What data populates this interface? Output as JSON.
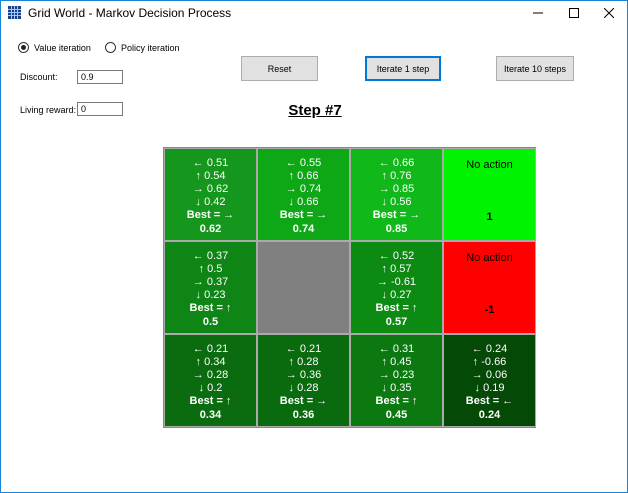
{
  "window": {
    "title": "Grid World - Markov Decision Process"
  },
  "controls": {
    "value_iteration_label": "Value iteration",
    "policy_iteration_label": "Policy iteration",
    "discount_label": "Discount:",
    "discount_value": "0.9",
    "living_reward_label": "Living reward:",
    "living_reward_value": "0",
    "selected_mode": "value_iteration"
  },
  "buttons": {
    "reset": "Reset",
    "iterate_1": "Iterate 1 step",
    "iterate_10": "Iterate 10 steps"
  },
  "step_title": "Step #7",
  "grid": {
    "rows": [
      [
        {
          "type": "q",
          "bg": "#15961c",
          "q": [
            "← 0.51",
            "↑ 0.54",
            "→ 0.62",
            "↓ 0.42"
          ],
          "best": "Best = →",
          "value": "0.62"
        },
        {
          "type": "q",
          "bg": "#0ea816",
          "q": [
            "← 0.55",
            "↑ 0.66",
            "→ 0.74",
            "↓ 0.66"
          ],
          "best": "Best = →",
          "value": "0.74"
        },
        {
          "type": "q",
          "bg": "#10b819",
          "q": [
            "← 0.66",
            "↑ 0.76",
            "→ 0.85",
            "↓ 0.56"
          ],
          "best": "Best = →",
          "value": "0.85"
        },
        {
          "type": "term",
          "bg": "#00f300",
          "label": "No action",
          "value": "1"
        }
      ],
      [
        {
          "type": "q",
          "bg": "#0e8514",
          "q": [
            "← 0.37",
            "↑ 0.5",
            "→ 0.37",
            "↓ 0.23"
          ],
          "best": "Best = ↑",
          "value": "0.5"
        },
        {
          "type": "wall",
          "bg": "#808080"
        },
        {
          "type": "q",
          "bg": "#0c8a12",
          "q": [
            "← 0.52",
            "↑ 0.57",
            "→ -0.61",
            "↓ 0.27"
          ],
          "best": "Best = ↑",
          "value": "0.57"
        },
        {
          "type": "term",
          "bg": "#ff0000",
          "label": "No action",
          "value": "-1"
        }
      ],
      [
        {
          "type": "q",
          "bg": "#0a6c0e",
          "q": [
            "← 0.21",
            "↑ 0.34",
            "→ 0.28",
            "↓ 0.2"
          ],
          "best": "Best = ↑",
          "value": "0.34"
        },
        {
          "type": "q",
          "bg": "#096b0d",
          "q": [
            "← 0.21",
            "↑ 0.28",
            "→ 0.36",
            "↓ 0.28"
          ],
          "best": "Best = →",
          "value": "0.36"
        },
        {
          "type": "q",
          "bg": "#0c7910",
          "q": [
            "← 0.31",
            "↑ 0.45",
            "→ 0.23",
            "↓ 0.35"
          ],
          "best": "Best = ↑",
          "value": "0.45"
        },
        {
          "type": "q",
          "bg": "#044a06",
          "q": [
            "← 0.24",
            "↑ -0.66",
            "→ 0.06",
            "↓ 0.19"
          ],
          "best": "Best = ←",
          "value": "0.24"
        }
      ]
    ]
  }
}
